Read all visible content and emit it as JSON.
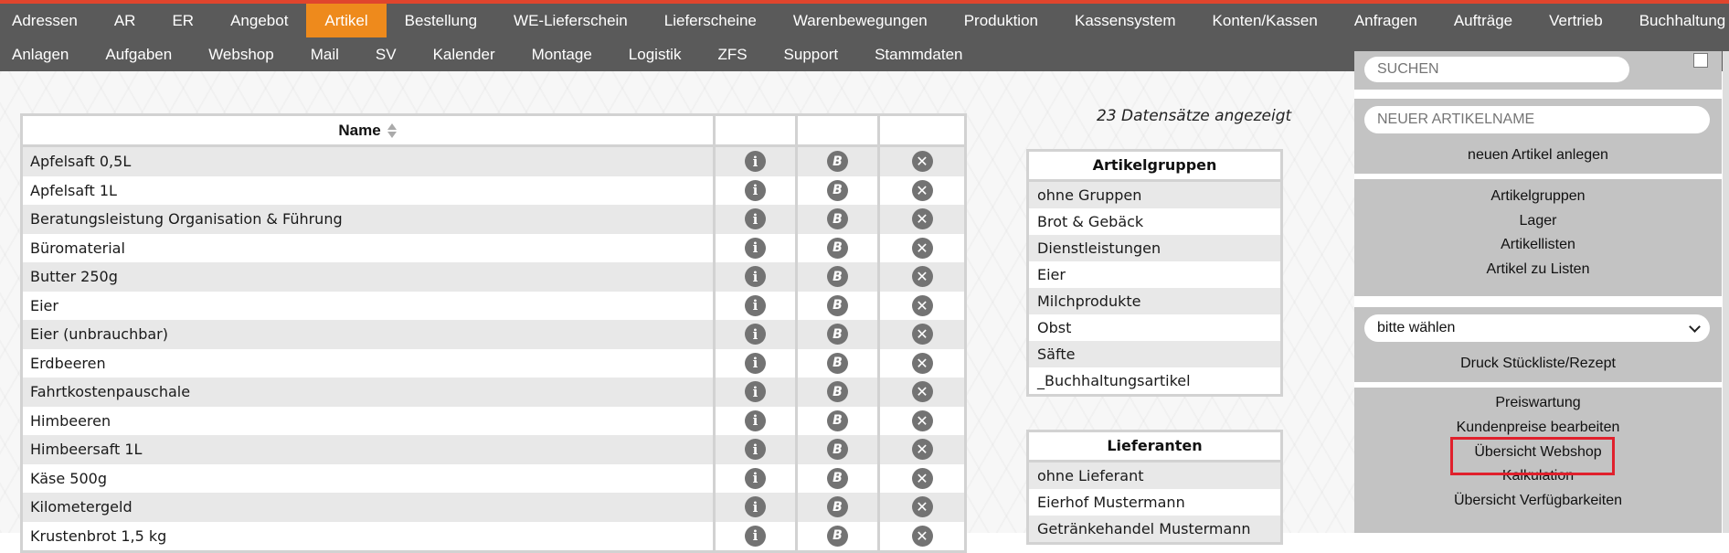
{
  "nav": {
    "row1": [
      "Adressen",
      "AR",
      "ER",
      "Angebot",
      "Artikel",
      "Bestellung",
      "WE-Lieferschein",
      "Lieferscheine",
      "Warenbewegungen",
      "Produktion",
      "Kassensystem",
      "Konten/Kassen",
      "Anfragen",
      "Aufträge",
      "Vertrieb",
      "Buchhaltung"
    ],
    "row2": [
      "Anlagen",
      "Aufgaben",
      "Webshop",
      "Mail",
      "SV",
      "Kalender",
      "Montage",
      "Logistik",
      "ZFS",
      "Support",
      "Stammdaten"
    ],
    "active": "Artikel"
  },
  "table": {
    "header": {
      "name": "Name"
    },
    "rows": [
      "Apfelsaft 0,5L",
      "Apfelsaft 1L",
      "Beratungsleistung Organisation & Führung",
      "Büromaterial",
      "Butter 250g",
      "Eier",
      "Eier (unbrauchbar)",
      "Erdbeeren",
      "Fahrtkostenpauschale",
      "Himbeeren",
      "Himbeersaft 1L",
      "Käse 500g",
      "Kilometergeld",
      "Krustenbrot 1,5 kg"
    ],
    "icons": {
      "info": "i",
      "b": "B",
      "x": "✕"
    }
  },
  "count_label": "23 Datensätze angezeigt",
  "artikelgruppen": {
    "title": "Artikelgruppen",
    "items": [
      "ohne Gruppen",
      "Brot & Gebäck",
      "Dienstleistungen",
      "Eier",
      "Milchprodukte",
      "Obst",
      "Säfte",
      "_Buchhaltungsartikel"
    ]
  },
  "lieferanten": {
    "title": "Lieferanten",
    "items": [
      "ohne Lieferant",
      "Eierhof Mustermann",
      "Getränkehandel Mustermann"
    ]
  },
  "panel": {
    "search_placeholder": "SUCHEN",
    "new_article_placeholder": "NEUER ARTIKELNAME",
    "new_article_button": "neuen Artikel anlegen",
    "links1": [
      "Artikelgruppen",
      "Lager",
      "Artikellisten",
      "Artikel zu Listen"
    ],
    "select_value": "bitte wählen",
    "print_button": "Druck Stückliste/Rezept",
    "links2": [
      "Preiswartung",
      "Kundenpreise bearbeiten",
      "Übersicht Webshop",
      "Kalkulation",
      "Übersicht Verfügbarkeiten"
    ]
  },
  "colors": {
    "nav_bg": "#5a5a5a",
    "active": "#ee8a1c",
    "accent": "#e0452d",
    "highlight": "#e0202c"
  }
}
